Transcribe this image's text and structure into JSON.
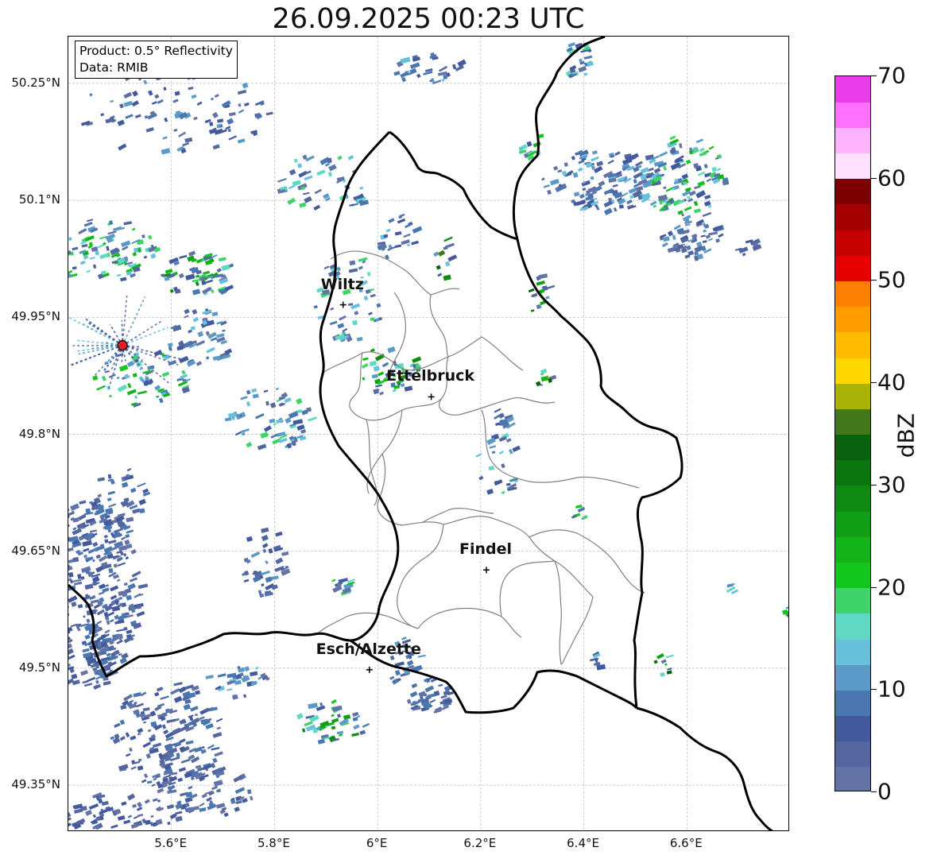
{
  "title": "26.09.2025 00:23 UTC",
  "info_box": {
    "product": "Product: 0.5° Reflectivity",
    "data_source": "Data: RMIB"
  },
  "axes": {
    "lat_labels": [
      "50.25°N",
      "50.1°N",
      "49.95°N",
      "49.8°N",
      "49.65°N",
      "49.5°N",
      "49.35°N"
    ],
    "lon_labels": [
      "5.6°E",
      "5.8°E",
      "6°E",
      "6.2°E",
      "6.4°E",
      "6.6°E"
    ]
  },
  "cities": [
    {
      "name": "Wiltz",
      "lat": 49.966,
      "lon": 5.933
    },
    {
      "name": "Ettelbruck",
      "lat": 49.848,
      "lon": 6.104
    },
    {
      "name": "Findel",
      "lat": 49.626,
      "lon": 6.211
    },
    {
      "name": "Esch/Alzette",
      "lat": 49.498,
      "lon": 5.984
    }
  ],
  "radar_site": {
    "lat": 49.914,
    "lon": 5.505
  },
  "colorbar": {
    "label": "dBZ",
    "ticks": [
      "0",
      "10",
      "20",
      "30",
      "40",
      "50",
      "60",
      "70"
    ],
    "min": 0,
    "max": 70,
    "colors": [
      "#6473a6",
      "#5366a0",
      "#42599e",
      "#4a77b0",
      "#5b9ac6",
      "#67c1dc",
      "#60d9c4",
      "#3ed46a",
      "#13c61c",
      "#12b418",
      "#109f14",
      "#0d8b11",
      "#0b7610",
      "#08620e",
      "#43781a",
      "#aab207",
      "#ffd700",
      "#ffbb00",
      "#ff9d00",
      "#ff7f00",
      "#e70000",
      "#c40000",
      "#a40000",
      "#7d0000",
      "#ffe0ff",
      "#ffb3ff",
      "#ff70ff",
      "#ea3ced"
    ]
  },
  "map_style": {
    "border_color": "#000000",
    "canton_color": "#808080",
    "grid_color": "#b8b8b8"
  }
}
